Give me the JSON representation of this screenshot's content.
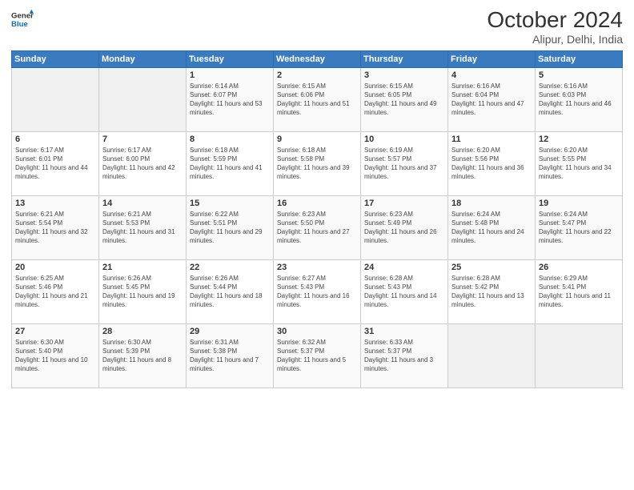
{
  "header": {
    "logo_line1": "General",
    "logo_line2": "Blue",
    "month": "October 2024",
    "location": "Alipur, Delhi, India"
  },
  "weekdays": [
    "Sunday",
    "Monday",
    "Tuesday",
    "Wednesday",
    "Thursday",
    "Friday",
    "Saturday"
  ],
  "weeks": [
    [
      {
        "day": "",
        "info": ""
      },
      {
        "day": "",
        "info": ""
      },
      {
        "day": "1",
        "info": "Sunrise: 6:14 AM\nSunset: 6:07 PM\nDaylight: 11 hours and 53 minutes."
      },
      {
        "day": "2",
        "info": "Sunrise: 6:15 AM\nSunset: 6:06 PM\nDaylight: 11 hours and 51 minutes."
      },
      {
        "day": "3",
        "info": "Sunrise: 6:15 AM\nSunset: 6:05 PM\nDaylight: 11 hours and 49 minutes."
      },
      {
        "day": "4",
        "info": "Sunrise: 6:16 AM\nSunset: 6:04 PM\nDaylight: 11 hours and 47 minutes."
      },
      {
        "day": "5",
        "info": "Sunrise: 6:16 AM\nSunset: 6:03 PM\nDaylight: 11 hours and 46 minutes."
      }
    ],
    [
      {
        "day": "6",
        "info": "Sunrise: 6:17 AM\nSunset: 6:01 PM\nDaylight: 11 hours and 44 minutes."
      },
      {
        "day": "7",
        "info": "Sunrise: 6:17 AM\nSunset: 6:00 PM\nDaylight: 11 hours and 42 minutes."
      },
      {
        "day": "8",
        "info": "Sunrise: 6:18 AM\nSunset: 5:59 PM\nDaylight: 11 hours and 41 minutes."
      },
      {
        "day": "9",
        "info": "Sunrise: 6:18 AM\nSunset: 5:58 PM\nDaylight: 11 hours and 39 minutes."
      },
      {
        "day": "10",
        "info": "Sunrise: 6:19 AM\nSunset: 5:57 PM\nDaylight: 11 hours and 37 minutes."
      },
      {
        "day": "11",
        "info": "Sunrise: 6:20 AM\nSunset: 5:56 PM\nDaylight: 11 hours and 36 minutes."
      },
      {
        "day": "12",
        "info": "Sunrise: 6:20 AM\nSunset: 5:55 PM\nDaylight: 11 hours and 34 minutes."
      }
    ],
    [
      {
        "day": "13",
        "info": "Sunrise: 6:21 AM\nSunset: 5:54 PM\nDaylight: 11 hours and 32 minutes."
      },
      {
        "day": "14",
        "info": "Sunrise: 6:21 AM\nSunset: 5:53 PM\nDaylight: 11 hours and 31 minutes."
      },
      {
        "day": "15",
        "info": "Sunrise: 6:22 AM\nSunset: 5:51 PM\nDaylight: 11 hours and 29 minutes."
      },
      {
        "day": "16",
        "info": "Sunrise: 6:23 AM\nSunset: 5:50 PM\nDaylight: 11 hours and 27 minutes."
      },
      {
        "day": "17",
        "info": "Sunrise: 6:23 AM\nSunset: 5:49 PM\nDaylight: 11 hours and 26 minutes."
      },
      {
        "day": "18",
        "info": "Sunrise: 6:24 AM\nSunset: 5:48 PM\nDaylight: 11 hours and 24 minutes."
      },
      {
        "day": "19",
        "info": "Sunrise: 6:24 AM\nSunset: 5:47 PM\nDaylight: 11 hours and 22 minutes."
      }
    ],
    [
      {
        "day": "20",
        "info": "Sunrise: 6:25 AM\nSunset: 5:46 PM\nDaylight: 11 hours and 21 minutes."
      },
      {
        "day": "21",
        "info": "Sunrise: 6:26 AM\nSunset: 5:45 PM\nDaylight: 11 hours and 19 minutes."
      },
      {
        "day": "22",
        "info": "Sunrise: 6:26 AM\nSunset: 5:44 PM\nDaylight: 11 hours and 18 minutes."
      },
      {
        "day": "23",
        "info": "Sunrise: 6:27 AM\nSunset: 5:43 PM\nDaylight: 11 hours and 16 minutes."
      },
      {
        "day": "24",
        "info": "Sunrise: 6:28 AM\nSunset: 5:43 PM\nDaylight: 11 hours and 14 minutes."
      },
      {
        "day": "25",
        "info": "Sunrise: 6:28 AM\nSunset: 5:42 PM\nDaylight: 11 hours and 13 minutes."
      },
      {
        "day": "26",
        "info": "Sunrise: 6:29 AM\nSunset: 5:41 PM\nDaylight: 11 hours and 11 minutes."
      }
    ],
    [
      {
        "day": "27",
        "info": "Sunrise: 6:30 AM\nSunset: 5:40 PM\nDaylight: 11 hours and 10 minutes."
      },
      {
        "day": "28",
        "info": "Sunrise: 6:30 AM\nSunset: 5:39 PM\nDaylight: 11 hours and 8 minutes."
      },
      {
        "day": "29",
        "info": "Sunrise: 6:31 AM\nSunset: 5:38 PM\nDaylight: 11 hours and 7 minutes."
      },
      {
        "day": "30",
        "info": "Sunrise: 6:32 AM\nSunset: 5:37 PM\nDaylight: 11 hours and 5 minutes."
      },
      {
        "day": "31",
        "info": "Sunrise: 6:33 AM\nSunset: 5:37 PM\nDaylight: 11 hours and 3 minutes."
      },
      {
        "day": "",
        "info": ""
      },
      {
        "day": "",
        "info": ""
      }
    ]
  ]
}
